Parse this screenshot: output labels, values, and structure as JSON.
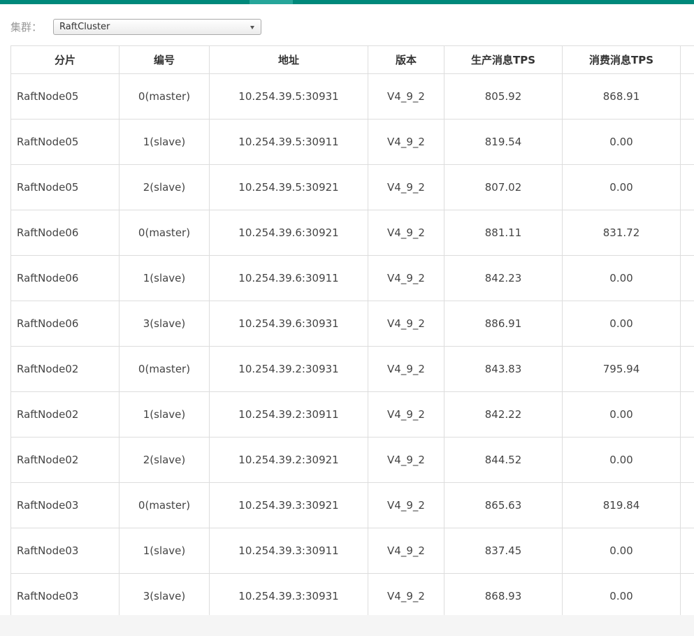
{
  "filter": {
    "label": "集群：",
    "selected": "RaftCluster"
  },
  "table": {
    "headers": [
      "分片",
      "编号",
      "地址",
      "版本",
      "生产消息TPS",
      "消费消息TPS",
      ""
    ],
    "rows": [
      [
        "RaftNode05",
        "0(master)",
        "10.254.39.5:30931",
        "V4_9_2",
        "805.92",
        "868.91",
        ""
      ],
      [
        "RaftNode05",
        "1(slave)",
        "10.254.39.5:30911",
        "V4_9_2",
        "819.54",
        "0.00",
        ""
      ],
      [
        "RaftNode05",
        "2(slave)",
        "10.254.39.5:30921",
        "V4_9_2",
        "807.02",
        "0.00",
        ""
      ],
      [
        "RaftNode06",
        "0(master)",
        "10.254.39.6:30921",
        "V4_9_2",
        "881.11",
        "831.72",
        ""
      ],
      [
        "RaftNode06",
        "1(slave)",
        "10.254.39.6:30911",
        "V4_9_2",
        "842.23",
        "0.00",
        ""
      ],
      [
        "RaftNode06",
        "3(slave)",
        "10.254.39.6:30931",
        "V4_9_2",
        "886.91",
        "0.00",
        ""
      ],
      [
        "RaftNode02",
        "0(master)",
        "10.254.39.2:30931",
        "V4_9_2",
        "843.83",
        "795.94",
        ""
      ],
      [
        "RaftNode02",
        "1(slave)",
        "10.254.39.2:30911",
        "V4_9_2",
        "842.22",
        "0.00",
        ""
      ],
      [
        "RaftNode02",
        "2(slave)",
        "10.254.39.2:30921",
        "V4_9_2",
        "844.52",
        "0.00",
        ""
      ],
      [
        "RaftNode03",
        "0(master)",
        "10.254.39.3:30921",
        "V4_9_2",
        "865.63",
        "819.84",
        ""
      ],
      [
        "RaftNode03",
        "1(slave)",
        "10.254.39.3:30911",
        "V4_9_2",
        "837.45",
        "0.00",
        ""
      ],
      [
        "RaftNode03",
        "3(slave)",
        "10.254.39.3:30931",
        "V4_9_2",
        "868.93",
        "0.00",
        ""
      ]
    ]
  }
}
